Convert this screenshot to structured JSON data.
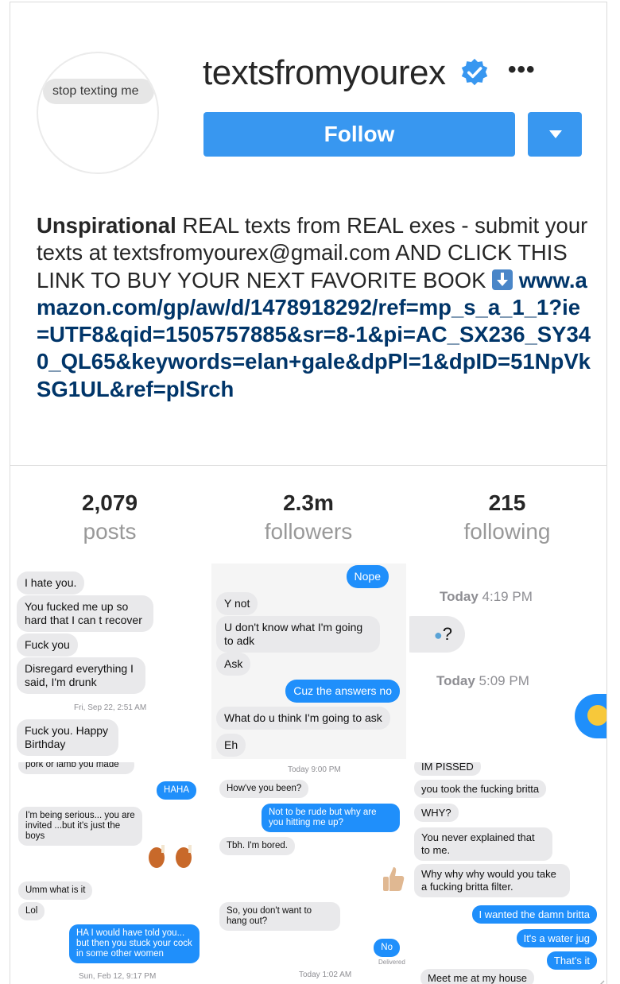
{
  "profile": {
    "avatar_text": "stop texting me",
    "username": "textsfromyourex",
    "follow_label": "Follow",
    "more_label": "•••",
    "bio": {
      "name": "Unspirational",
      "text": " REAL texts from REAL exes - submit your texts at textsfromyourex@gmail.com AND CLICK THIS LINK TO BUY YOUR NEXT FAVORITE BOOK ",
      "link": "www.amazon.com/gp/aw/d/1478918292/ref=mp_s_a_1_1?ie=UTF8&qid=1505757885&sr=8-1&pi=AC_SX236_SY340_QL65&keywords=elan+gale&dpPl=1&dpID=51NpVkSG1UL&ref=plSrch"
    },
    "colors": {
      "accent": "#3897f0",
      "link": "#003569",
      "imessage_blue": "#1f8ffb",
      "bubble_gray": "#e9e9eb"
    }
  },
  "stats": [
    {
      "value": "2,079",
      "label": "posts"
    },
    {
      "value": "2.3m",
      "label": "followers"
    },
    {
      "value": "215",
      "label": "following"
    }
  ],
  "posts": [
    {
      "msgs": [
        "I hate you.",
        "You fucked me up so hard that I can t recover",
        "Fuck you",
        "Disregard everything I said, I'm drunk",
        "Fuck you. Happy Birthday"
      ],
      "timestamp": "Fri, Sep 22, 2:51 AM"
    },
    {
      "msgs": [
        "Nope",
        "Y not",
        "U don't know what I'm going to adk",
        "Ask",
        "Cuz the answers no",
        "What do u think I'm going to ask",
        "Eh"
      ]
    },
    {
      "timestamp1": "Today",
      "time1": "4:19 PM",
      "msg": "?",
      "timestamp2": "Today",
      "time2": "5:09 PM"
    },
    {
      "msgs": [
        "pork or lamb you made",
        "HAHA",
        "I'm being serious... you are invited ...but it's just the boys",
        "Umm what is it",
        "Lol",
        "HA I would have told you... but then you stuck your cock in some other women"
      ],
      "timestamp": "Sun, Feb 12, 9:17 PM"
    },
    {
      "timestamp": "Today 9:00 PM",
      "msgs": [
        "How've you been?",
        "Not to be rude but why are you hitting me up?",
        "Tbh. I'm bored.",
        "So, you don't want to hang out?",
        "No"
      ],
      "delivered": "Delivered",
      "timestamp2": "Today 1:02 AM"
    },
    {
      "msgs": [
        "IM PISSED",
        "you took the fucking britta",
        "WHY?",
        "You never explained that to me.",
        "Why why why would you take a fucking britta filter.",
        "I wanted the damn britta",
        "It's a water jug",
        "That's it",
        "Meet me at my house"
      ]
    }
  ]
}
